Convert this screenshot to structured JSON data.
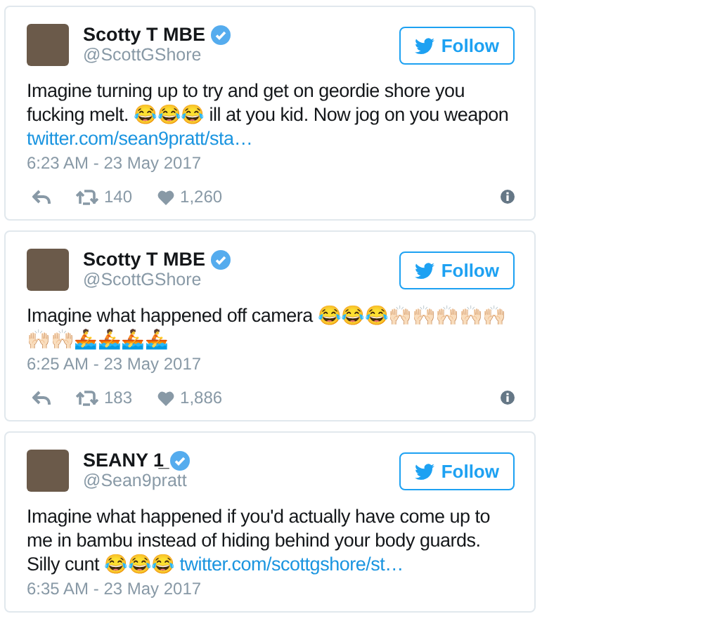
{
  "tweets": [
    {
      "name": "Scotty T MBE",
      "handle": "@ScottGShore",
      "verified": true,
      "follow": "Follow",
      "text": "Imagine turning up to try and get on geordie shore you fucking melt. 😂😂😂 ill at you kid. Now jog on you weapon ",
      "link": "twitter.com/sean9pratt/sta…",
      "time": "6:23 AM - 23 May 2017",
      "retweets": "140",
      "likes": "1,260"
    },
    {
      "name": "Scotty T MBE",
      "handle": "@ScottGShore",
      "verified": true,
      "follow": "Follow",
      "text": "Imagine what happened off camera 😂😂😂🙌🏻🙌🏻🙌🏻🙌🏻🙌🏻🙌🏻🙌🏻🚣🚣🚣🚣",
      "time": "6:25 AM - 23 May 2017",
      "retweets": "183",
      "likes": "1,886"
    },
    {
      "name": "SEANY 1̲",
      "handle": "@Sean9pratt",
      "verified": true,
      "follow": "Follow",
      "text": "Imagine what happened if you'd actually have come up to me in bambu instead of hiding behind your body guards. Silly cunt 😂😂😂 ",
      "link": "twitter.com/scottgshore/st…",
      "time": "6:35 AM - 23 May 2017"
    }
  ]
}
